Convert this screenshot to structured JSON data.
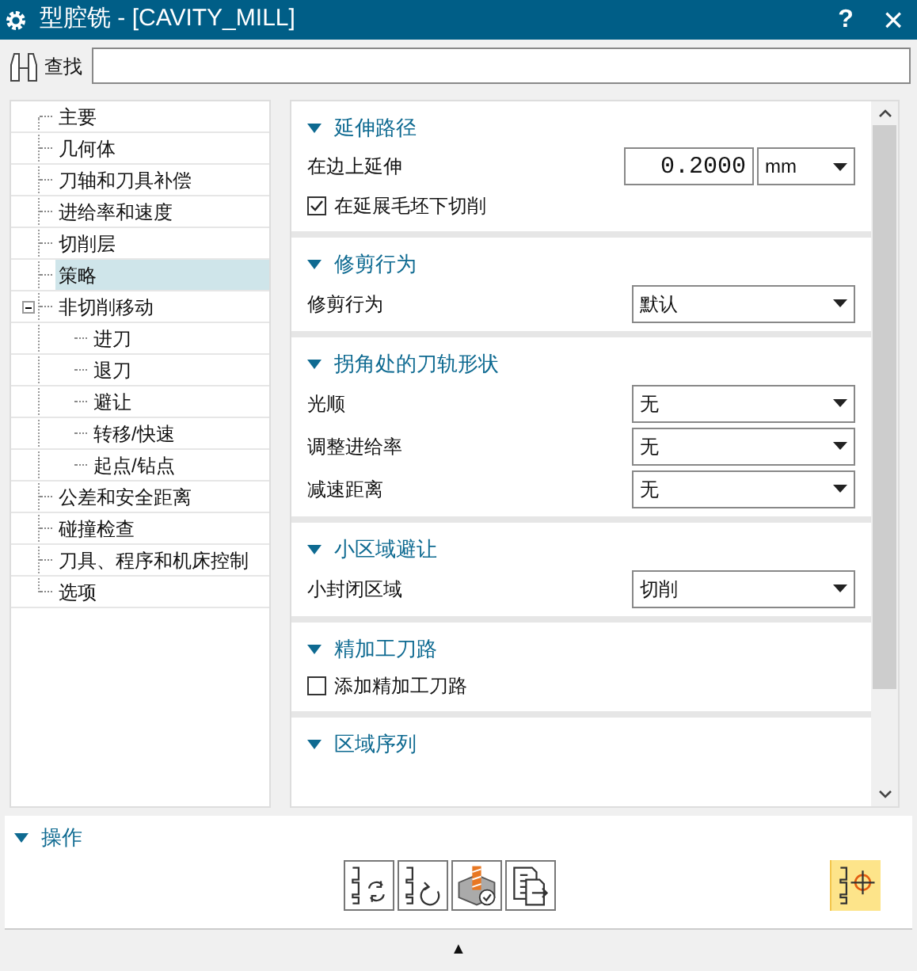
{
  "window": {
    "title": "型腔铣 - [CAVITY_MILL]",
    "help": "?",
    "close": "×"
  },
  "search": {
    "label": "查找"
  },
  "tree": [
    {
      "label": "主要",
      "selected": false
    },
    {
      "label": "几何体",
      "selected": false
    },
    {
      "label": "刀轴和刀具补偿",
      "selected": false
    },
    {
      "label": "进给率和速度",
      "selected": false
    },
    {
      "label": "切削层",
      "selected": false
    },
    {
      "label": "策略",
      "selected": true
    },
    {
      "label": "非切削移动",
      "selected": false,
      "expanded": true,
      "children": [
        {
          "label": "进刀",
          "selected": false
        },
        {
          "label": "退刀",
          "selected": false
        },
        {
          "label": "避让",
          "selected": false
        },
        {
          "label": "转移/快速",
          "selected": false
        },
        {
          "label": "起点/钻点",
          "selected": false
        }
      ]
    },
    {
      "label": "公差和安全距离",
      "selected": false
    },
    {
      "label": "碰撞检查",
      "selected": false
    },
    {
      "label": "刀具、程序和机床控制",
      "selected": false
    },
    {
      "label": "选项",
      "selected": false
    }
  ],
  "sections": [
    {
      "title": "延伸路径",
      "expanded": true,
      "rows": [
        {
          "kind": "number",
          "label": "在边上延伸",
          "value": "0.2000",
          "unit": "mm"
        },
        {
          "kind": "checkbox",
          "label": "在延展毛坯下切削",
          "checked": true
        }
      ]
    },
    {
      "title": "修剪行为",
      "expanded": true,
      "rows": [
        {
          "kind": "select",
          "label": "修剪行为",
          "value": "默认"
        }
      ]
    },
    {
      "title": "拐角处的刀轨形状",
      "expanded": true,
      "rows": [
        {
          "kind": "select",
          "label": "光顺",
          "value": "无"
        },
        {
          "kind": "select",
          "label": "调整进给率",
          "value": "无"
        },
        {
          "kind": "select",
          "label": "减速距离",
          "value": "无"
        }
      ]
    },
    {
      "title": "小区域避让",
      "expanded": true,
      "rows": [
        {
          "kind": "select",
          "label": "小封闭区域",
          "value": "切削"
        }
      ]
    },
    {
      "title": "精加工刀路",
      "expanded": true,
      "rows": [
        {
          "kind": "checkbox",
          "label": "添加精加工刀路",
          "checked": false
        }
      ]
    },
    {
      "title": "区域序列",
      "expanded": true
    }
  ],
  "operations": {
    "title": "操作",
    "expanded": true,
    "actions": [
      {
        "kind": "generate",
        "highlighted": false
      },
      {
        "kind": "replay",
        "highlighted": false
      },
      {
        "kind": "verify",
        "highlighted": false
      },
      {
        "kind": "list",
        "highlighted": false
      },
      {
        "kind": "display",
        "highlighted": true
      }
    ]
  },
  "collapse_arrow": "▲"
}
